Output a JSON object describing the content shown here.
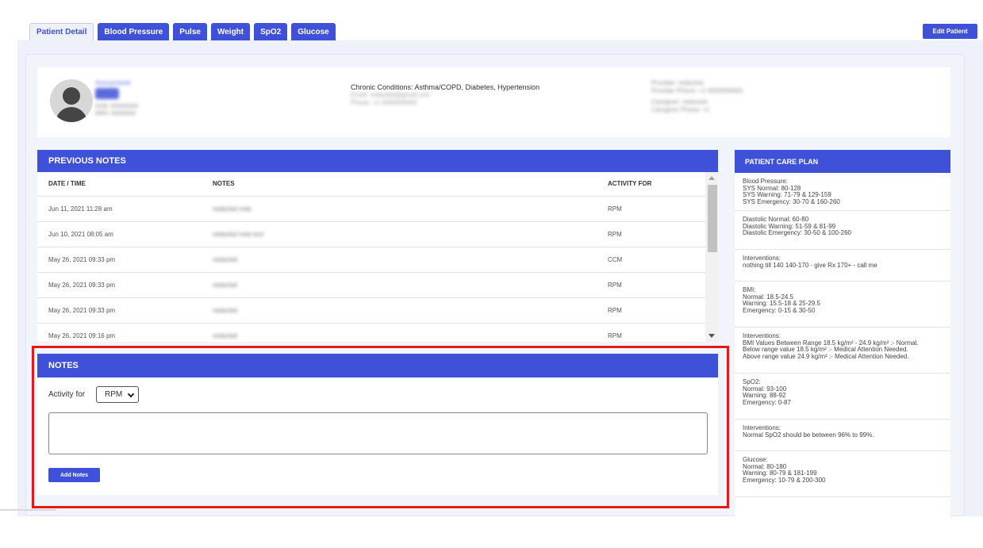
{
  "tabs": [
    {
      "label": "Patient Detail",
      "active": true
    },
    {
      "label": "Blood Pressure",
      "active": false
    },
    {
      "label": "Pulse",
      "active": false
    },
    {
      "label": "Weight",
      "active": false
    },
    {
      "label": "SpO2",
      "active": false
    },
    {
      "label": "Glucose",
      "active": false
    }
  ],
  "edit_patient_label": "Edit Patient",
  "profile": {
    "name": "Anonymized",
    "line1": "DOB: 00/00/0000",
    "line2": "MRN: 00000000",
    "chronic_conditions": "Chronic Conditions: Asthma/COPD, Diabetes, Hypertension",
    "email": "Email: redacted@gmail.com",
    "phone": "Phone: +1 0000000000",
    "provider": "Provider: redacted",
    "provider_phone": "Provider Phone: +1 0000000000",
    "caregiver": "Caregiver: redacted",
    "caregiver_phone": "Caregiver Phone: +1"
  },
  "previous_notes": {
    "title": "PREVIOUS NOTES",
    "columns": [
      "DATE / TIME",
      "NOTES",
      "ACTIVITY FOR"
    ],
    "rows": [
      {
        "date": "Jun 11, 2021 11:28 am",
        "note": "redacted note",
        "activity": "RPM"
      },
      {
        "date": "Jun 10, 2021 08:05 am",
        "note": "redacted note text",
        "activity": "RPM"
      },
      {
        "date": "May 26, 2021 09:33 pm",
        "note": "redacted",
        "activity": "CCM"
      },
      {
        "date": "May 26, 2021 09:33 pm",
        "note": "redacted",
        "activity": "RPM"
      },
      {
        "date": "May 26, 2021 09:33 pm",
        "note": "redacted",
        "activity": "RPM"
      },
      {
        "date": "May 26, 2021 09:16 pm",
        "note": "redacted",
        "activity": "RPM"
      }
    ]
  },
  "notes_form": {
    "title": "NOTES",
    "activity_label": "Activity for",
    "activity_value": "RPM",
    "textarea_value": "",
    "add_button_label": "Add Notes"
  },
  "care_plan": {
    "title": "PATIENT CARE PLAN",
    "items": [
      "Blood Pressure:\nSYS Normal: 80-128\nSYS Warning: 71-79 & 129-159\nSYS Emergency: 30-70 & 160-260",
      "Diastolic Normal: 60-80\nDiastolic Warning: 51-59 & 81-99\nDiastolic Emergency: 30-50 & 100-260",
      "Interventions:\nnothing till 140 140-170 - give Rx 170+ - call me",
      "BMI:\nNormal: 18.5-24.5\nWarning: 15.5-18 & 25-29.5\nEmergency: 0-15 & 30-50",
      "Interventions:\nBMI Values Between Range 18.5 kg/m² - 24.9 kg/m² :- Normal.\nBelow range value 18.5 kg/m² :- Medical Attention Needed.\nAbove range value 24.9 kg/m² :- Medical Attention Needed.",
      "SpO2:\nNormal: 93-100\nWarning: 88-92\nEmergency: 0-87",
      "Interventions:\nNormal SpO2 should be between 96% to 99%.",
      "Glucose:\nNormal: 80-180\nWarning: 80-79 & 181-199\nEmergency: 10-79 & 200-300"
    ]
  },
  "colors": {
    "accent": "#3f51d8",
    "highlight": "#e31a1c"
  }
}
